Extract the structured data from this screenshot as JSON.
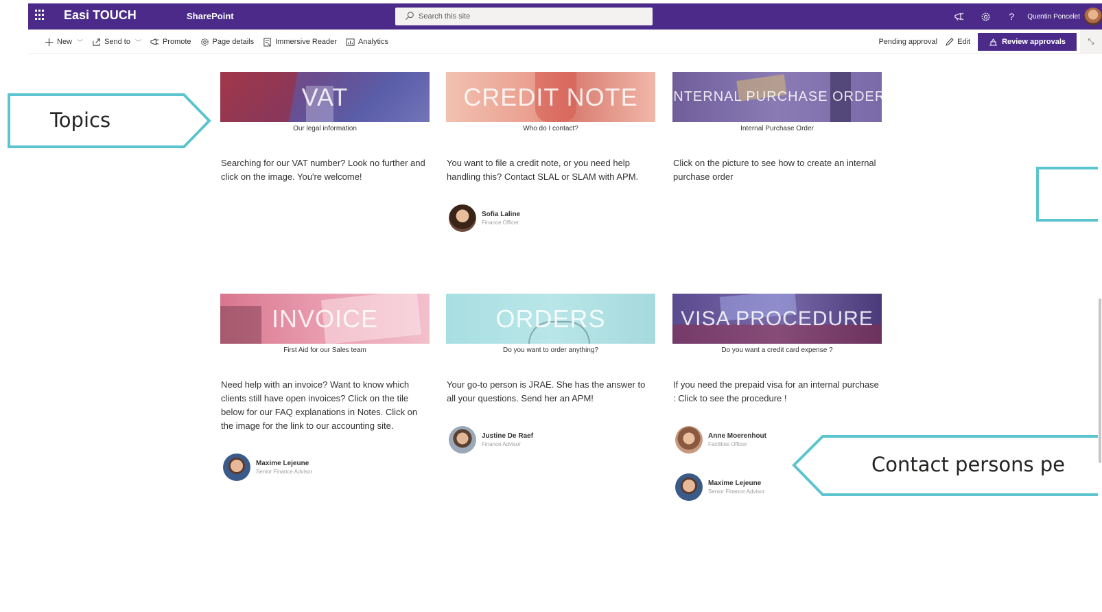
{
  "suite": {
    "site_title": "Easi TOUCH",
    "app_name": "SharePoint",
    "search_placeholder": "Search this site",
    "user_name": "Quentin Poncelet",
    "accent_color": "#4b2a8a"
  },
  "command_bar": {
    "new_label": "New",
    "send_to_label": "Send to",
    "promote_label": "Promote",
    "page_details_label": "Page details",
    "immersive_reader_label": "Immersive Reader",
    "analytics_label": "Analytics",
    "pending_label": "Pending approval",
    "edit_label": "Edit",
    "review_label": "Review approvals"
  },
  "tiles": [
    {
      "title": "VAT",
      "caption": "Our legal information",
      "description": "Searching for our VAT number? Look no further and click on the image. You're welcome!",
      "contacts": []
    },
    {
      "title": "CREDIT NOTE",
      "caption": "Who do I contact?",
      "description": "You want to file a credit note, or you need help handling this? Contact SLAL or SLAM with APM.",
      "contacts": [
        {
          "name": "Sofia Laline",
          "role": "Finance Officer"
        }
      ]
    },
    {
      "title": "INTERNAL PURCHASE ORDER",
      "caption": "Internal Purchase Order",
      "description": "Click on the picture to see how to create an internal purchase order",
      "contacts": []
    },
    {
      "title": "INVOICE",
      "caption": "First Aid for our Sales team",
      "description": "Need help with an invoice? Want to know which clients still have open invoices? Click on the tile below for our FAQ explanations in Notes. Click on the image for the link to our accounting site.",
      "contacts": [
        {
          "name": "Maxime Lejeune",
          "role": "Senior Finance Advisor"
        }
      ]
    },
    {
      "title": "ORDERS",
      "caption": "Do you want to order anything?",
      "description": "Your go-to person is JRAE. She has the answer to all your questions. Send her an APM!",
      "contacts": [
        {
          "name": "Justine De Raef",
          "role": "Finance Advisor"
        }
      ]
    },
    {
      "title": "VISA PROCEDURE",
      "caption": "Do you want a credit card expense ?",
      "description": "If you need the prepaid visa for an internal purchase :  Click to see the procedure !",
      "contacts": [
        {
          "name": "Anne Moerenhout",
          "role": "Facilities Officer"
        },
        {
          "name": "Maxime Lejeune",
          "role": "Senior Finance Advisor"
        }
      ]
    }
  ],
  "annotations": {
    "topics_label": "Topics",
    "contacts_label": "Contact persons pe",
    "callout_color": "#5bc4cf"
  }
}
